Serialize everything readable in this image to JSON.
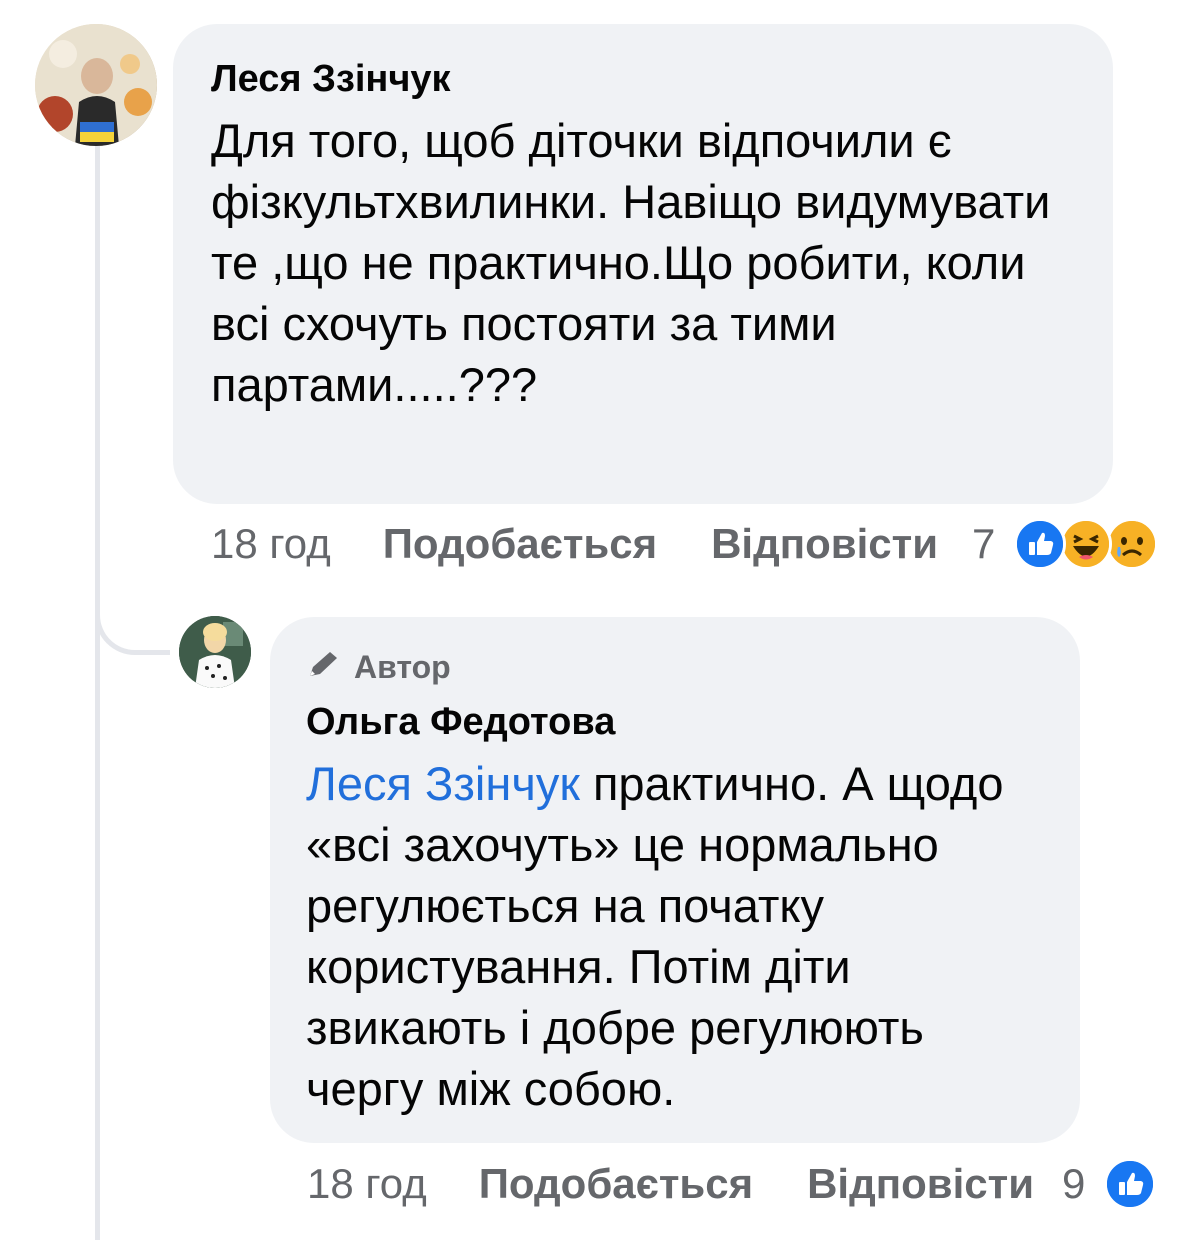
{
  "comments": [
    {
      "author": "Леся Ззінчук",
      "text": "Для того, щоб діточки відпочили є фізкультхвилинки. Навіщо видумувати те ,що не практично.Що робити, коли всі схочуть постояти за тими партами.....???",
      "time": "18 год",
      "like_label": "Подобається",
      "reply_label": "Відповісти",
      "reaction_count": "7",
      "reactions": [
        "like-icon",
        "haha-icon",
        "sad-icon"
      ]
    },
    {
      "badge": "Автор",
      "author": "Ольга Федотова",
      "mention": "Леся Ззінчук",
      "text": " практично. А щодо «всі захочуть» це нормально регулюється на початку користування. Потім діти звикають і добре регулюють чергу між собою.",
      "time": "18 год",
      "like_label": "Подобається",
      "reply_label": "Відповісти",
      "reaction_count": "9",
      "reactions": [
        "like-icon"
      ]
    }
  ],
  "colors": {
    "bubble": "#f0f2f5",
    "meta": "#65676b",
    "mention": "#216fdb",
    "like": "#1877f2",
    "emoji": "#f7b125"
  }
}
